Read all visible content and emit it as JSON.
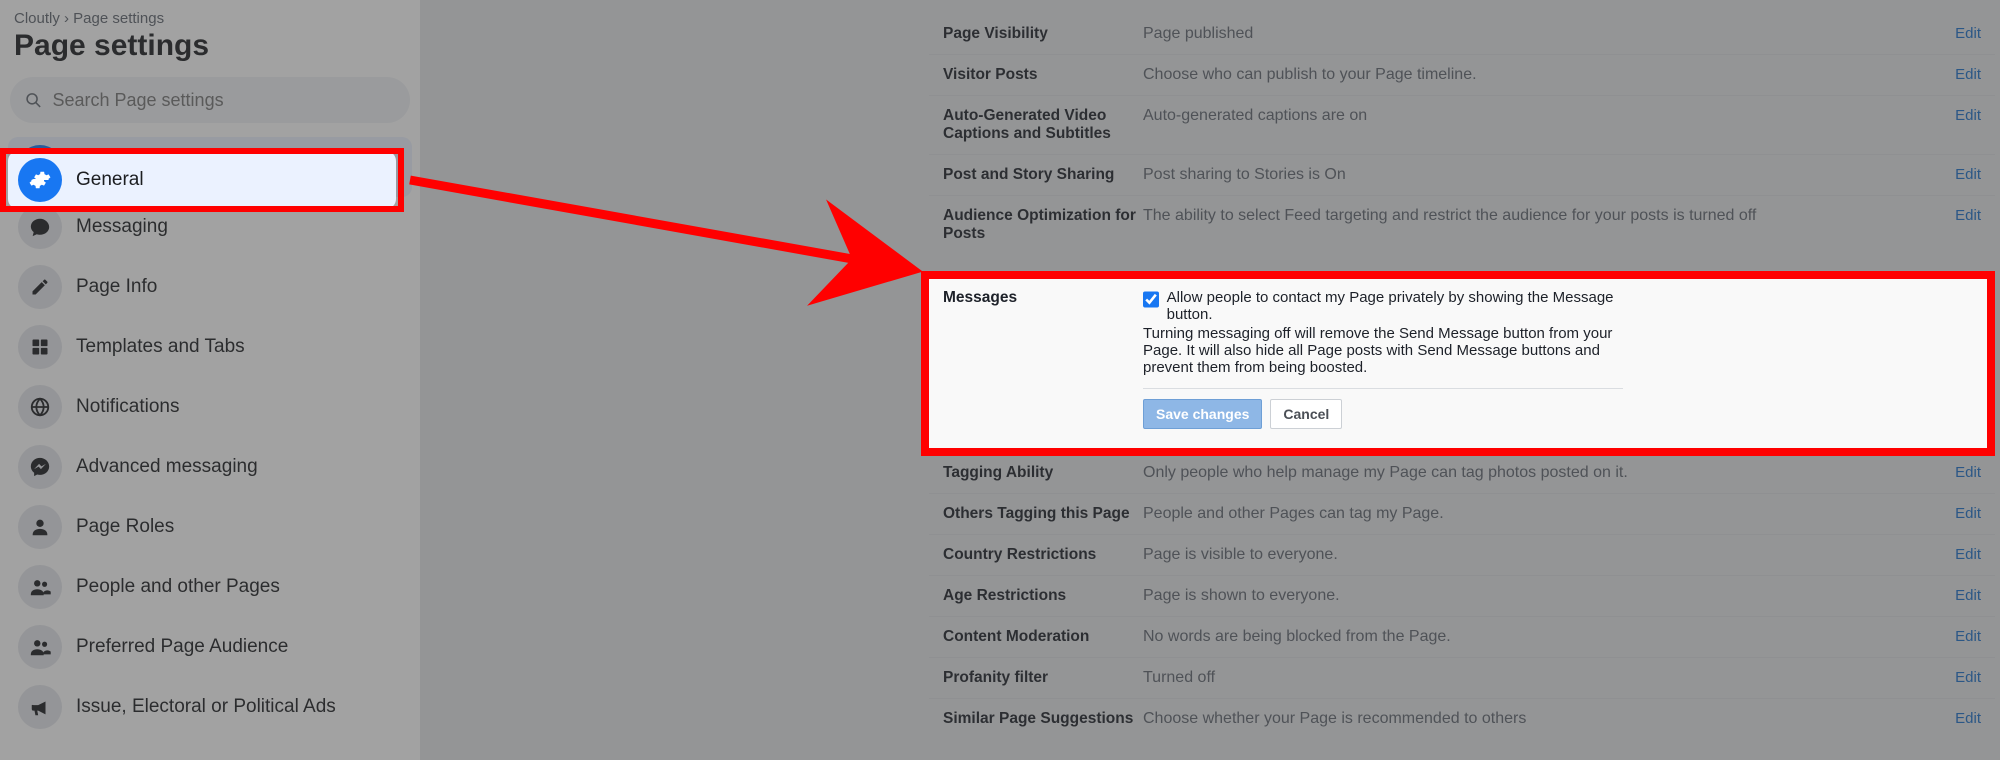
{
  "breadcrumb": "Cloutly › Page settings",
  "page_title": "Page settings",
  "search_placeholder": "Search Page settings",
  "sidebar_items": [
    {
      "label": "General",
      "icon": "gear-icon",
      "active": true
    },
    {
      "label": "Messaging",
      "icon": "chat-icon"
    },
    {
      "label": "Page Info",
      "icon": "pencil-icon"
    },
    {
      "label": "Templates and Tabs",
      "icon": "grid-icon"
    },
    {
      "label": "Notifications",
      "icon": "globe-icon"
    },
    {
      "label": "Advanced messaging",
      "icon": "messenger-icon"
    },
    {
      "label": "Page Roles",
      "icon": "person-icon"
    },
    {
      "label": "People and other Pages",
      "icon": "people-icon"
    },
    {
      "label": "Preferred Page Audience",
      "icon": "people-icon"
    },
    {
      "label": "Issue, Electoral or Political Ads",
      "icon": "megaphone-icon"
    }
  ],
  "rows_top": [
    {
      "label": "Page Visibility",
      "desc": "Page published",
      "edit": "Edit"
    },
    {
      "label": "Visitor Posts",
      "desc": "Choose who can publish to your Page timeline.",
      "edit": "Edit"
    },
    {
      "label": "Auto-Generated Video Captions and Subtitles",
      "desc": "Auto-generated captions are on",
      "edit": "Edit"
    },
    {
      "label": "Post and Story Sharing",
      "desc": "Post sharing to Stories is On",
      "edit": "Edit"
    },
    {
      "label": "Audience Optimization for Posts",
      "desc": "The ability to select Feed targeting and restrict the audience for your posts is turned off",
      "edit": "Edit"
    }
  ],
  "messages": {
    "label": "Messages",
    "checkbox_text": "Allow people to contact my Page privately by showing the Message button.",
    "sub_text": "Turning messaging off will remove the Send Message button from your Page. It will also hide all Page posts with Send Message buttons and prevent them from being boosted.",
    "save": "Save changes",
    "cancel": "Cancel"
  },
  "rows_bottom": [
    {
      "label": "Tagging Ability",
      "desc": "Only people who help manage my Page can tag photos posted on it.",
      "edit": "Edit"
    },
    {
      "label": "Others Tagging this Page",
      "desc": "People and other Pages can tag my Page.",
      "edit": "Edit"
    },
    {
      "label": "Country Restrictions",
      "desc": "Page is visible to everyone.",
      "edit": "Edit"
    },
    {
      "label": "Age Restrictions",
      "desc": "Page is shown to everyone.",
      "edit": "Edit"
    },
    {
      "label": "Content Moderation",
      "desc": "No words are being blocked from the Page.",
      "edit": "Edit"
    },
    {
      "label": "Profanity filter",
      "desc": "Turned off",
      "edit": "Edit"
    },
    {
      "label": "Similar Page Suggestions",
      "desc": "Choose whether your Page is recommended to others",
      "edit": "Edit"
    }
  ]
}
